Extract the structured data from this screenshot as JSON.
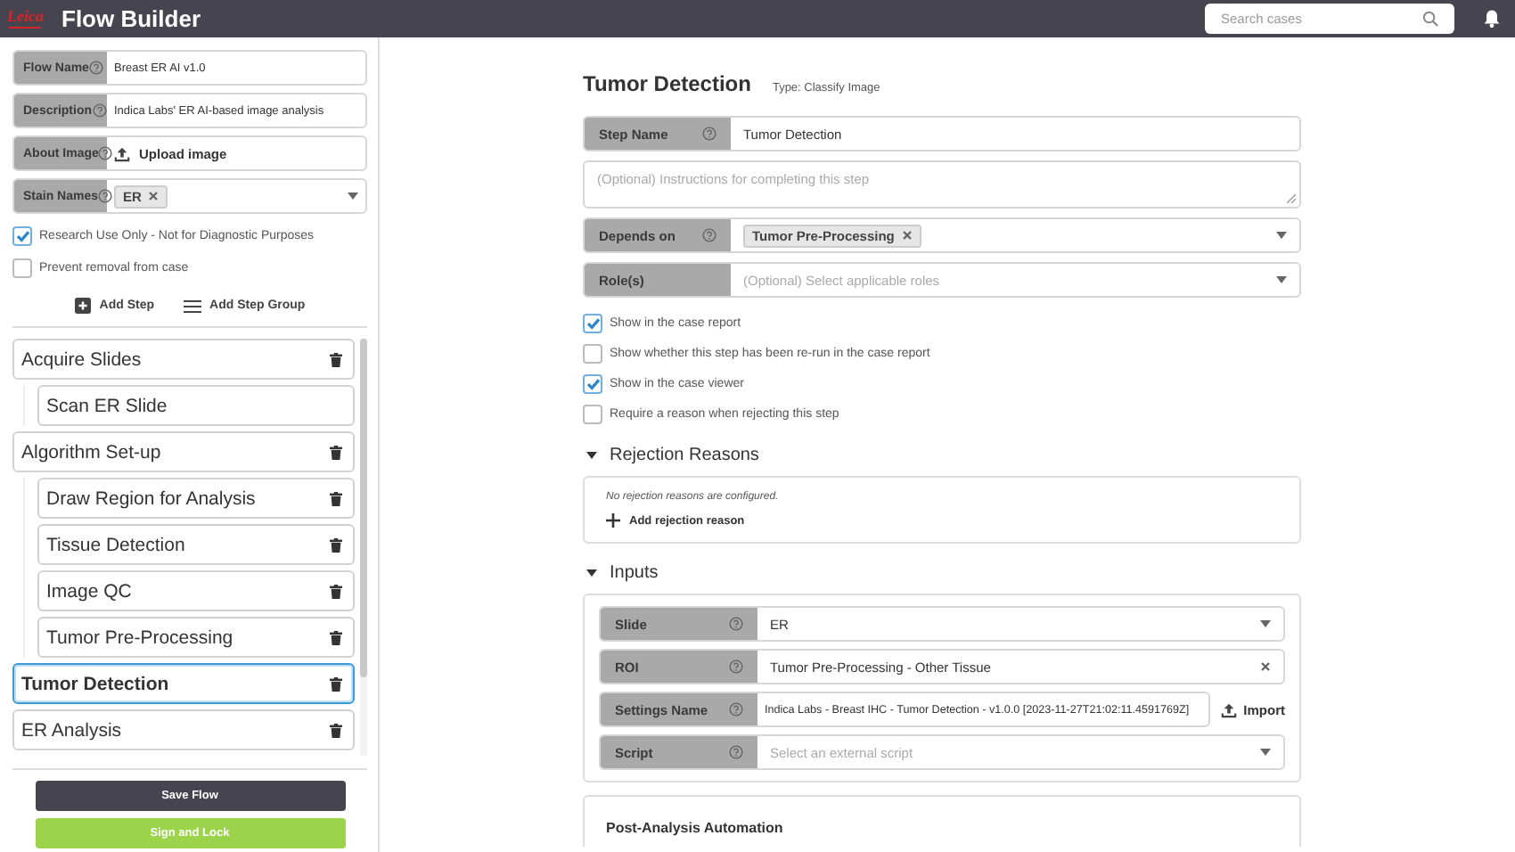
{
  "header": {
    "logo": "Leica",
    "title": "Flow Builder",
    "search": {
      "placeholder": "Search cases"
    }
  },
  "sidebar": {
    "fields": [
      {
        "kind": "text",
        "label": "Flow Name",
        "help": true,
        "value": "Breast ER AI v1.0"
      },
      {
        "kind": "text",
        "label": "Description",
        "help": true,
        "value": "Indica Labs' ER AI-based image analysis"
      },
      {
        "kind": "upload",
        "label": "About Image",
        "help": true,
        "action": "Upload image"
      },
      {
        "kind": "tags",
        "label": "Stain Names",
        "help": true,
        "tags": [
          "ER"
        ]
      }
    ],
    "checkboxes": [
      {
        "label": "Research Use Only - Not for Diagnostic Purposes",
        "checked": true
      },
      {
        "label": "Prevent removal from case",
        "checked": false
      }
    ],
    "actions": [
      {
        "kind": "step",
        "label": "Add Step"
      },
      {
        "kind": "group",
        "label": "Add Step Group"
      }
    ],
    "steps": [
      {
        "label": "Acquire Slides",
        "selected": false,
        "deletable": true,
        "children": [
          {
            "label": "Scan ER Slide",
            "selected": false,
            "deletable": false
          }
        ]
      },
      {
        "label": "Algorithm Set-up",
        "selected": false,
        "deletable": true,
        "children": [
          {
            "label": "Draw Region for Analysis",
            "selected": false,
            "deletable": true
          },
          {
            "label": "Tissue Detection",
            "selected": false,
            "deletable": true
          },
          {
            "label": "Image QC",
            "selected": false,
            "deletable": true
          },
          {
            "label": "Tumor Pre-Processing",
            "selected": false,
            "deletable": true
          }
        ]
      },
      {
        "label": "Tumor Detection",
        "selected": true,
        "deletable": true
      },
      {
        "label": "ER Analysis",
        "selected": false,
        "deletable": true
      }
    ],
    "buttons": [
      {
        "kind": "primary",
        "label": "Save Flow"
      },
      {
        "kind": "success",
        "label": "Sign and Lock"
      }
    ]
  },
  "main": {
    "title": "Tumor Detection",
    "type": "Type: Classify Image",
    "fields": [
      {
        "kind": "text",
        "label": "Step Name",
        "help": true,
        "value": "Tumor Detection"
      },
      {
        "kind": "textarea",
        "placeholder": "(Optional) Instructions for completing this step"
      },
      {
        "kind": "tags",
        "label": "Depends on",
        "help": true,
        "tags": [
          "Tumor Pre-Processing"
        ]
      },
      {
        "kind": "select",
        "label": "Role(s)",
        "help": false,
        "placeholder": "(Optional) Select applicable roles"
      }
    ],
    "options": [
      {
        "label": "Show in the case report",
        "checked": true
      },
      {
        "label": "Show whether this step has been re-run in the case report",
        "checked": false
      },
      {
        "label": "Show in the case viewer",
        "checked": true
      },
      {
        "label": "Require a reason when rejecting this step",
        "checked": false
      }
    ],
    "rejection": {
      "title": "Rejection Reasons",
      "expanded": true,
      "empty": "No rejection reasons are configured.",
      "action": "Add rejection reason"
    },
    "inputs": {
      "title": "Inputs",
      "expanded": true,
      "fields": [
        {
          "kind": "select",
          "label": "Slide",
          "help": true,
          "value": "ER"
        },
        {
          "kind": "clearable",
          "label": "ROI",
          "help": true,
          "value": "Tumor Pre-Processing - Other Tissue"
        },
        {
          "kind": "import",
          "label": "Settings Name",
          "help": true,
          "value": "Indica Labs - Breast IHC - Tumor Detection - v1.0.0 [2023-11-27T21:02:11.4591769Z]",
          "action": "Import"
        },
        {
          "kind": "select",
          "label": "Script",
          "help": true,
          "placeholder": "Select an external script"
        }
      ]
    },
    "post": {
      "title": "Post-Analysis Automation"
    }
  }
}
